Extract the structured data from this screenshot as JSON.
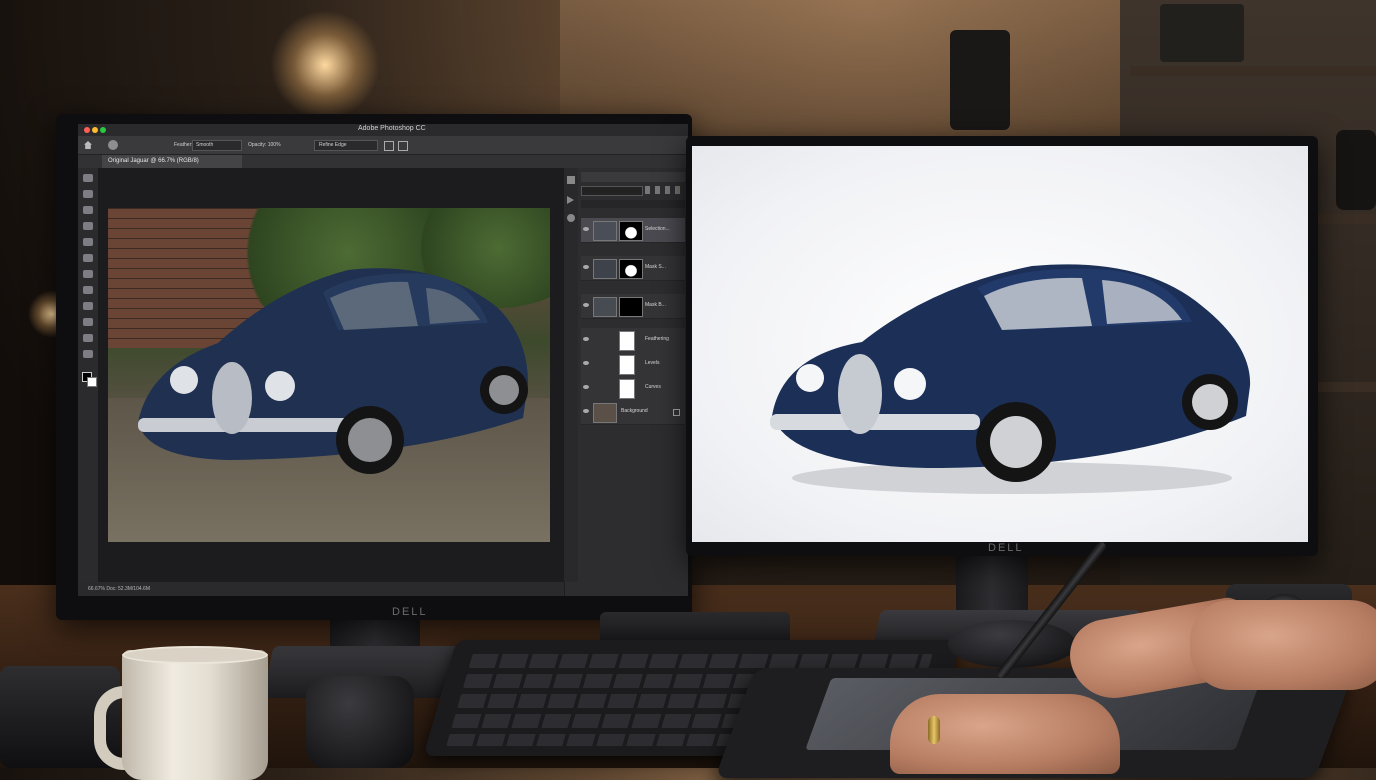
{
  "scene": "dual-monitor photo editing desk",
  "photoshop": {
    "app_title": "Adobe Photoshop CC",
    "document_tab": "Original Jaguar @ 66.7% (RGB/8)",
    "options_bar": [
      "Feather:",
      "Smooth",
      "Opacity: 100%",
      "Refine Edge"
    ],
    "layers": [
      {
        "label": "Selection..."
      },
      {
        "label": "Mask S..."
      },
      {
        "label": "Mask B..."
      },
      {
        "label": "Feathering"
      },
      {
        "label": "Levels"
      },
      {
        "label": "Curves"
      },
      {
        "label": "Background"
      }
    ],
    "status_text": "66.67%   Doc: 52.3M/104.6M"
  },
  "monitor_brand": "DELL",
  "colors": {
    "car_body": "#1f3050",
    "car_body_restored": "#1b2f57",
    "chrome": "#c9ccd2",
    "ps_bg": "#323234"
  },
  "icons": [
    "move-icon",
    "marquee-icon",
    "lasso-icon",
    "crop-icon",
    "eyedropper-icon",
    "brush-icon",
    "eraser-icon",
    "gradient-icon",
    "type-icon",
    "pen-icon",
    "zoom-icon",
    "hand-icon"
  ]
}
